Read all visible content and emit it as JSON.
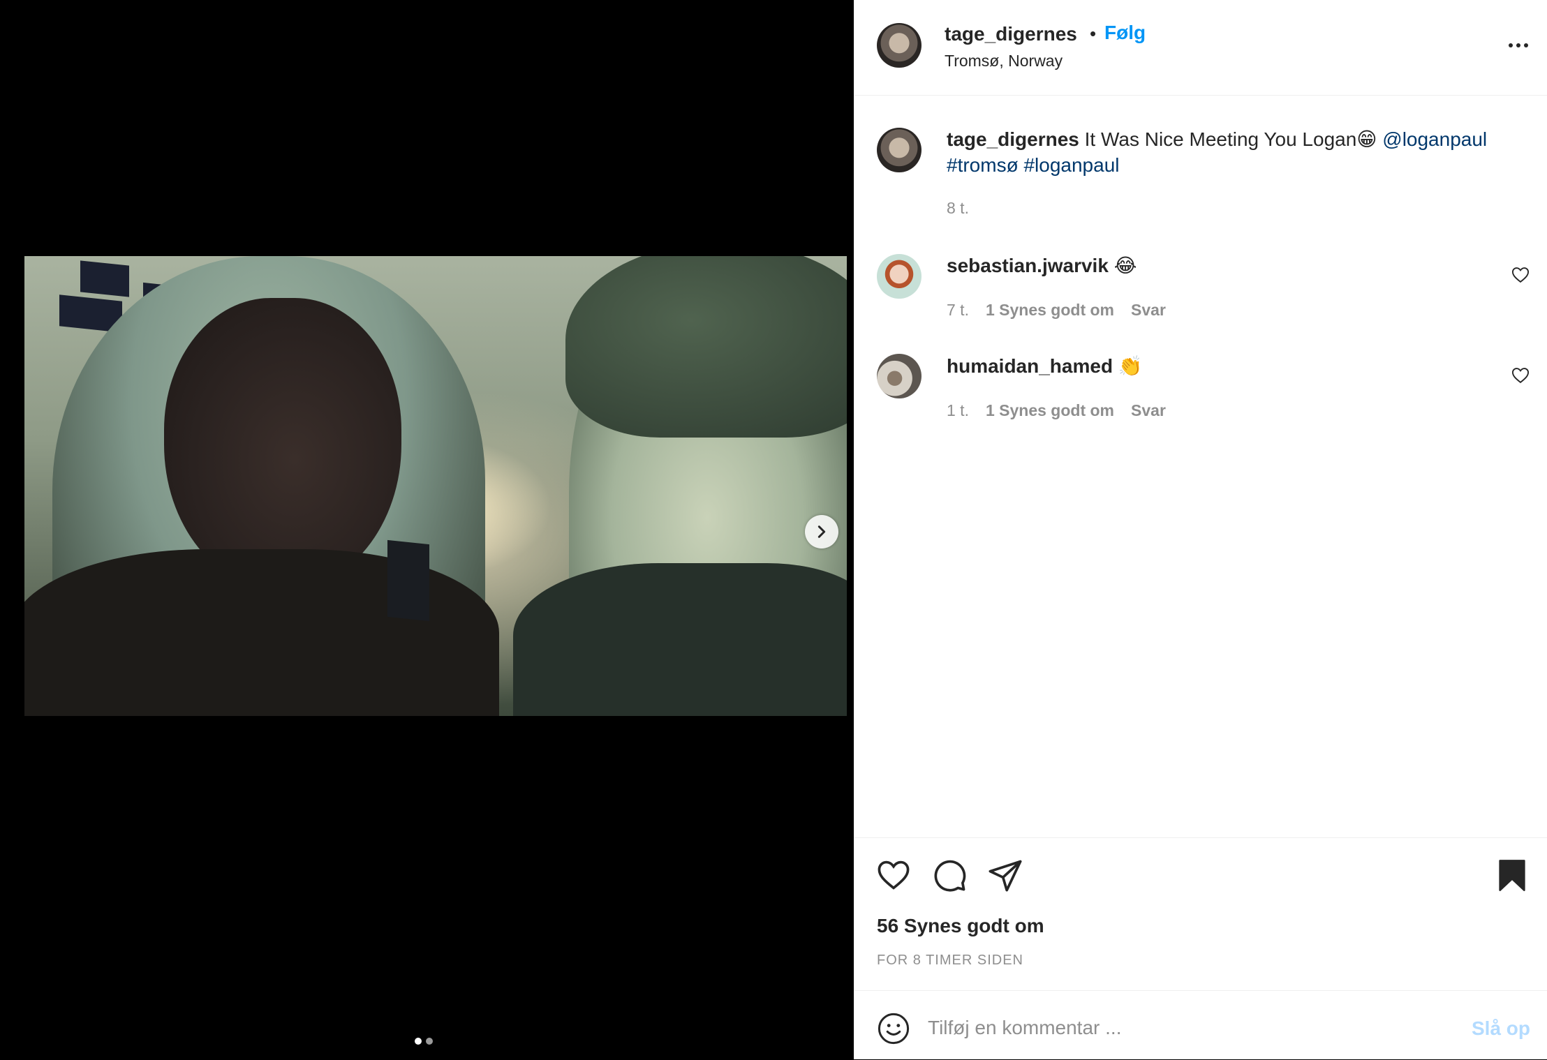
{
  "post": {
    "username": "tage_digernes",
    "separator": "•",
    "follow_label": "Følg",
    "location": "Tromsø, Norway",
    "caption_text": "It Was Nice Meeting You Logan😁",
    "caption_mention": "@loganpaul",
    "caption_tags": [
      "#tromsø",
      "#loganpaul"
    ],
    "caption_time": "8 t."
  },
  "comments": [
    {
      "username": "sebastian.jwarvik",
      "text": "😂",
      "time": "7 t.",
      "likes": "1 Synes godt om",
      "reply": "Svar"
    },
    {
      "username": "humaidan_hamed",
      "text": "👏",
      "time": "1 t.",
      "likes": "1 Synes godt om",
      "reply": "Svar"
    }
  ],
  "footer": {
    "likes": "56 Synes godt om",
    "time_ago": "FOR 8 TIMER SIDEN",
    "comment_placeholder": "Tilføj en kommentar ...",
    "post_label": "Slå op"
  },
  "carousel": {
    "count": 2,
    "active": 0
  },
  "icons": {
    "next": "chevron-right-icon",
    "more": "more-horizontal-icon",
    "like": "heart-icon",
    "comment": "comment-icon",
    "share": "send-icon",
    "save": "bookmark-icon",
    "emoji": "smiley-icon"
  },
  "colors": {
    "link": "#00376b",
    "follow": "#0095f6",
    "post_disabled": "#b3dbff",
    "meta": "#8e8e8e"
  }
}
